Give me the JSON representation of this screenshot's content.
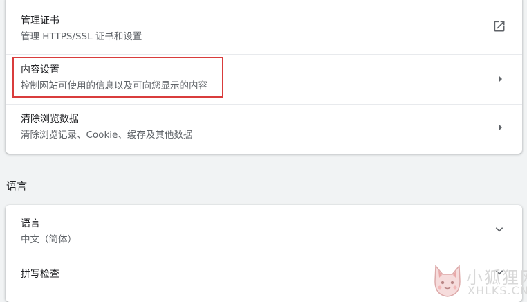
{
  "privacy_card": {
    "rows": [
      {
        "title": "管理证书",
        "subtitle": "管理 HTTPS/SSL 证书和设置",
        "icon": "open-in-new-icon"
      },
      {
        "title": "内容设置",
        "subtitle": "控制网站可使用的信息以及可向您显示的内容",
        "icon": "chevron-right-icon"
      },
      {
        "title": "清除浏览数据",
        "subtitle": "清除浏览记录、Cookie、缓存及其他数据",
        "icon": "chevron-right-icon"
      }
    ]
  },
  "language_section": {
    "heading": "语言",
    "rows": [
      {
        "title": "语言",
        "subtitle": "中文（简体）",
        "icon": "chevron-down-icon"
      },
      {
        "title": "拼写检查",
        "icon": "chevron-down-icon"
      }
    ]
  },
  "watermark": {
    "title": "小狐狸网",
    "subtitle": "XHLKS.CN"
  },
  "colors": {
    "highlight_border": "#d93c3c",
    "background": "#f1f3f4",
    "card": "#ffffff",
    "icon": "#5f6368"
  }
}
